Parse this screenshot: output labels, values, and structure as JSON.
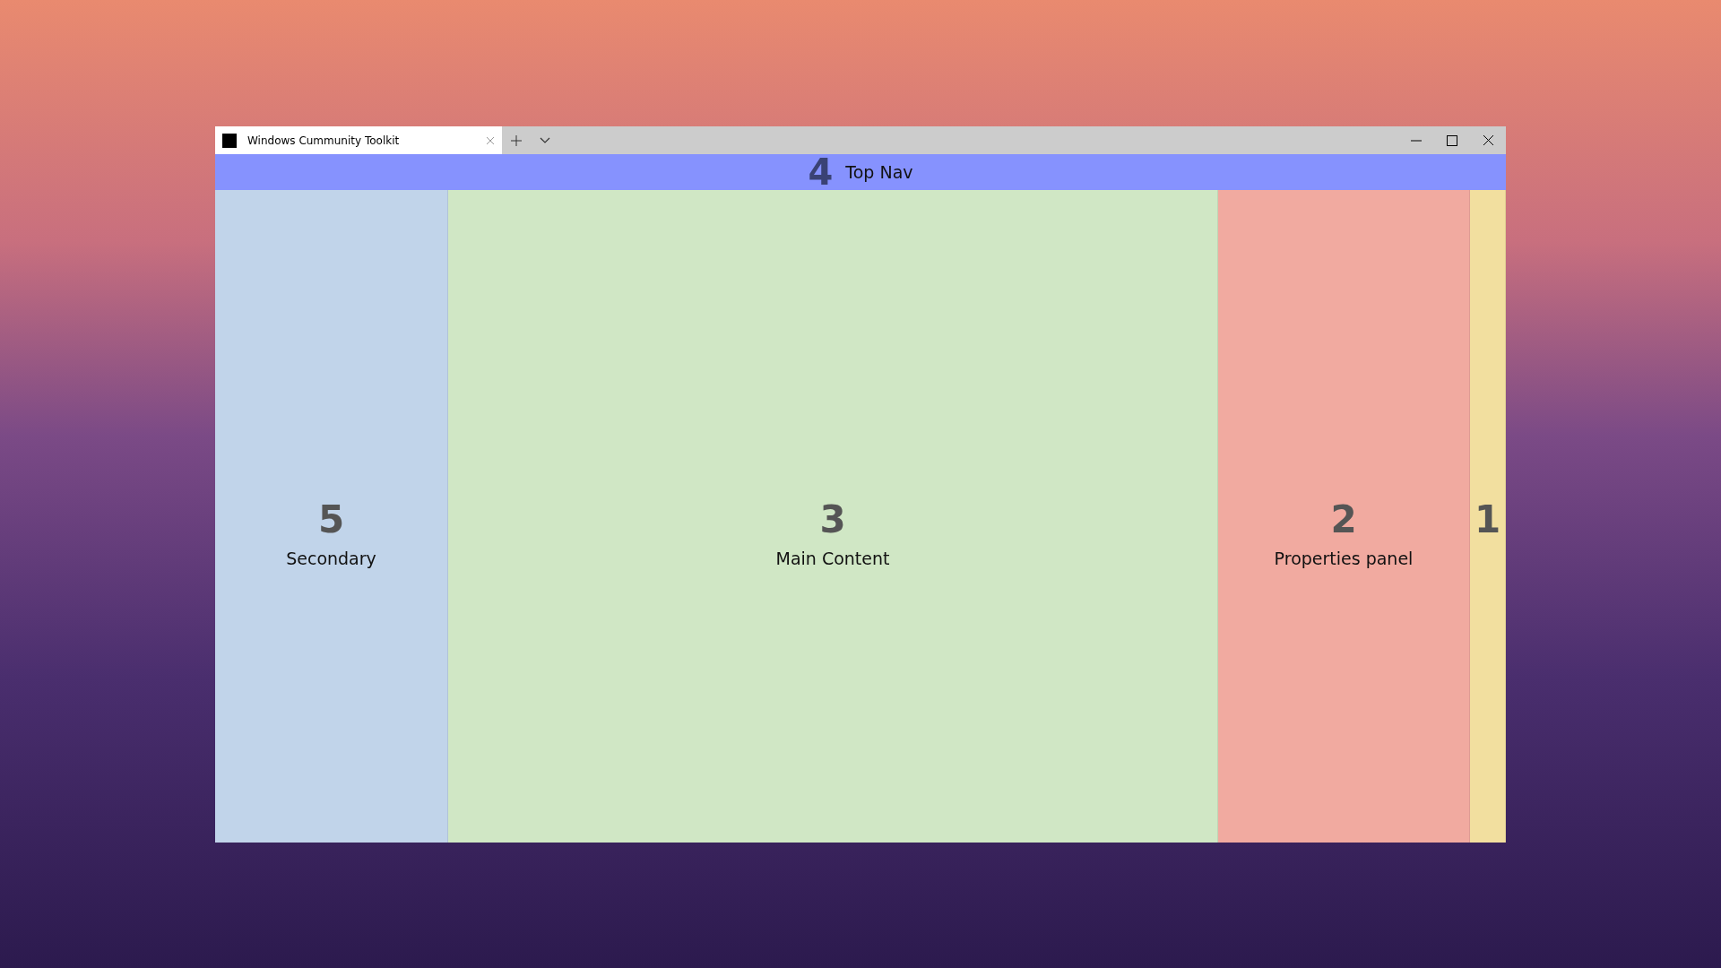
{
  "window": {
    "tab_title": "Windows Cummunity Toolkit"
  },
  "top_nav": {
    "number": "4",
    "label": "Top Nav"
  },
  "panels": [
    {
      "number": "5",
      "label": "Secondary",
      "color": "#c1d4ea"
    },
    {
      "number": "3",
      "label": "Main Content",
      "color": "#d0e7c5"
    },
    {
      "number": "2",
      "label": "Properties panel",
      "color": "#f1aaa0"
    },
    {
      "number": "1",
      "color": "#f2df9f"
    }
  ]
}
